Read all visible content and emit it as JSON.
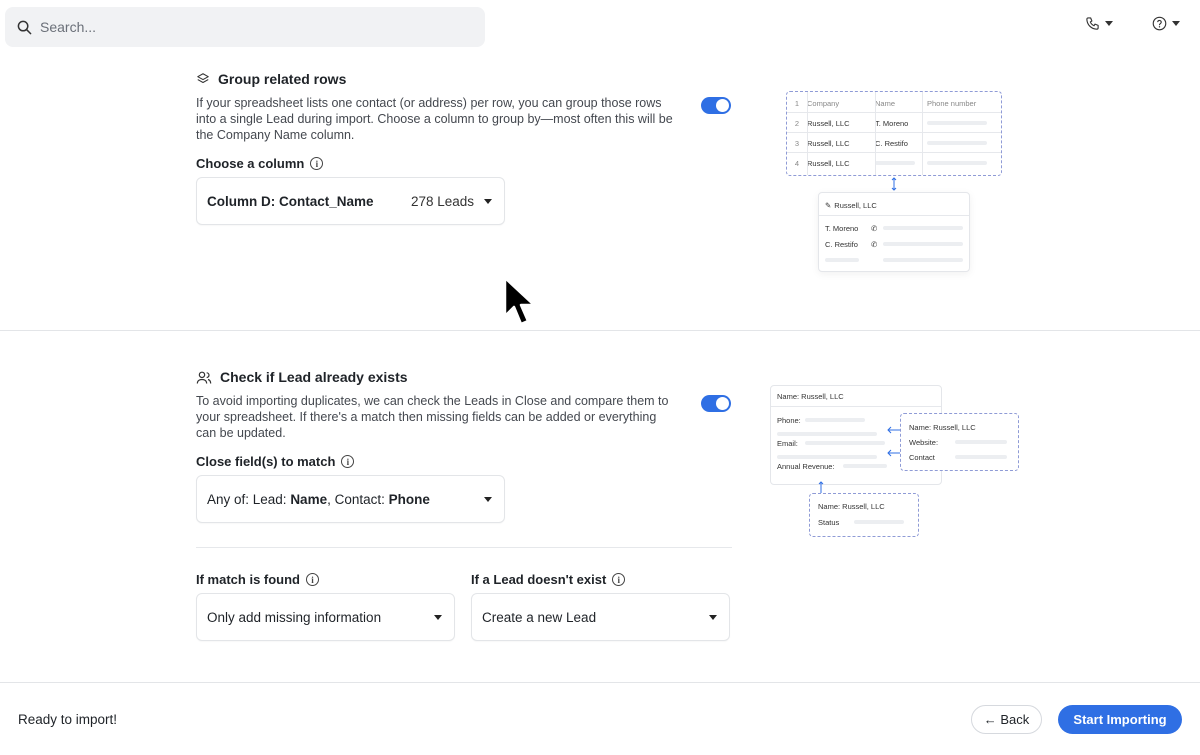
{
  "search": {
    "placeholder": "Search..."
  },
  "header": {
    "phone_icon": "phone-icon",
    "help_icon": "help-icon"
  },
  "group_rows": {
    "title": "Group related rows",
    "icon": "layers-icon",
    "description": "If your spreadsheet lists one contact (or address) per row, you can group those rows into a single Lead during import. Choose a column to group by—most often this will be the Company Name column.",
    "enabled": true,
    "column_label": "Choose a column",
    "column_value": "Column D: Contact_Name",
    "column_count": "278 Leads",
    "illustration": {
      "headers": [
        "Company",
        "Name",
        "Phone number"
      ],
      "rows": [
        {
          "num": "2",
          "company": "Russell, LLC",
          "name": "T. Moreno"
        },
        {
          "num": "3",
          "company": "Russell, LLC",
          "name": "C. Restifo"
        },
        {
          "num": "4",
          "company": "Russell, LLC",
          "name": ""
        }
      ],
      "header_num": "1",
      "lead_name": "Russell, LLC",
      "contacts": [
        "T. Moreno",
        "C. Restifo"
      ]
    }
  },
  "check_exists": {
    "title": "Check if Lead already exists",
    "icon": "users-icon",
    "description": "To avoid importing duplicates, we can check the Leads in Close and compare them to your spreadsheet. If there's a match then missing fields can be added or everything can be updated.",
    "enabled": true,
    "match_label": "Close field(s) to match",
    "match_prefix": "Any of: Lead: ",
    "match_field1": "Name",
    "match_mid": ", Contact: ",
    "match_field2": "Phone",
    "if_found_label": "If match is found",
    "if_found_value": "Only add missing information",
    "if_not_exist_label": "If a Lead doesn't exist",
    "if_not_exist_value": "Create a new Lead",
    "illustration": {
      "sheet_name": "Name: Russell, LLC",
      "sheet_fields": [
        "Phone:",
        "Email:",
        "Annual Revenue:"
      ],
      "lead_name": "Name: Russell, LLC",
      "lead_fields": [
        "Website:",
        "Contact"
      ],
      "bottom_name": "Name: Russell, LLC",
      "bottom_field": "Status"
    }
  },
  "footer": {
    "status": "Ready to import!",
    "back_label": "← Back",
    "start_label": "Start Importing"
  },
  "colors": {
    "accent": "#2f6fe4",
    "dashed_border": "#8f9bd6"
  }
}
